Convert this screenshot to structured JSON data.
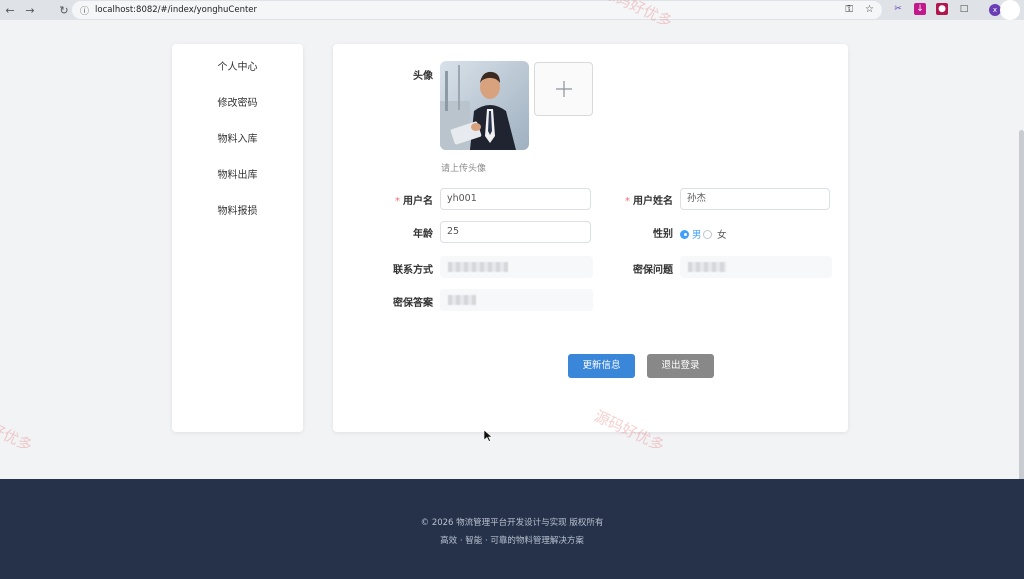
{
  "browser": {
    "url": "localhost:8082/#/index/yonghuCenter",
    "profile_initial": "x"
  },
  "sidebar": {
    "items": [
      {
        "label": "个人中心"
      },
      {
        "label": "修改密码"
      },
      {
        "label": "物料入库"
      },
      {
        "label": "物料出库"
      },
      {
        "label": "物料报损"
      }
    ]
  },
  "form": {
    "avatar_label": "头像",
    "avatar_hint": "请上传头像",
    "required_mark": "*",
    "username_label": "用户名",
    "username_value": "yh001",
    "realname_label": "用户姓名",
    "realname_value": "孙杰",
    "age_label": "年龄",
    "age_value": "25",
    "gender_label": "性别",
    "gender_male": "男",
    "gender_female": "女",
    "gender_selected": "男",
    "contact_label": "联系方式",
    "question_label": "密保问题",
    "answer_label": "密保答案",
    "update_button": "更新信息",
    "logout_button": "退出登录"
  },
  "footer": {
    "copyright": "© 2026 物流管理平台开发设计与实现 版权所有",
    "tagline": "高效 · 智能 · 可靠的物料管理解决方案"
  },
  "watermark": "源码好优多",
  "colors": {
    "primary": "#3a86d8",
    "secondary_button": "#888888",
    "footer_bg": "#25324a",
    "required": "#f56c6c"
  }
}
